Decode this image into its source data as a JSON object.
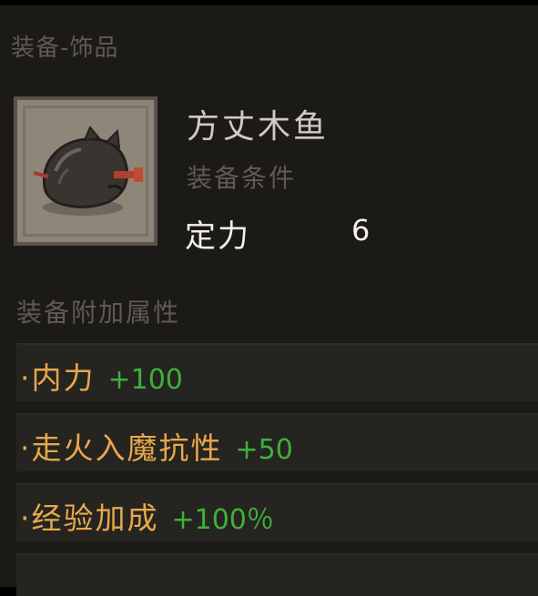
{
  "panel": {
    "section_title": "装备-饰品"
  },
  "item": {
    "icon": "wooden-fish-icon",
    "name": "方丈木鱼",
    "requirement_title": "装备条件",
    "requirement": {
      "stat": "定力",
      "value": "6"
    }
  },
  "attributes": {
    "title": "装备附加属性",
    "rows": [
      {
        "name": "·内力",
        "value": "+100"
      },
      {
        "name": "·走火入魔抗性",
        "value": "+50"
      },
      {
        "name": "·经验加成",
        "value": "+100％"
      }
    ]
  },
  "colors": {
    "panel_bg": "#1c1a17",
    "row_bg": "#262420",
    "attr_name": "#e7a84c",
    "attr_value": "#3cb23c",
    "muted_text": "#5f5a52",
    "title_text": "#cfcac2"
  }
}
